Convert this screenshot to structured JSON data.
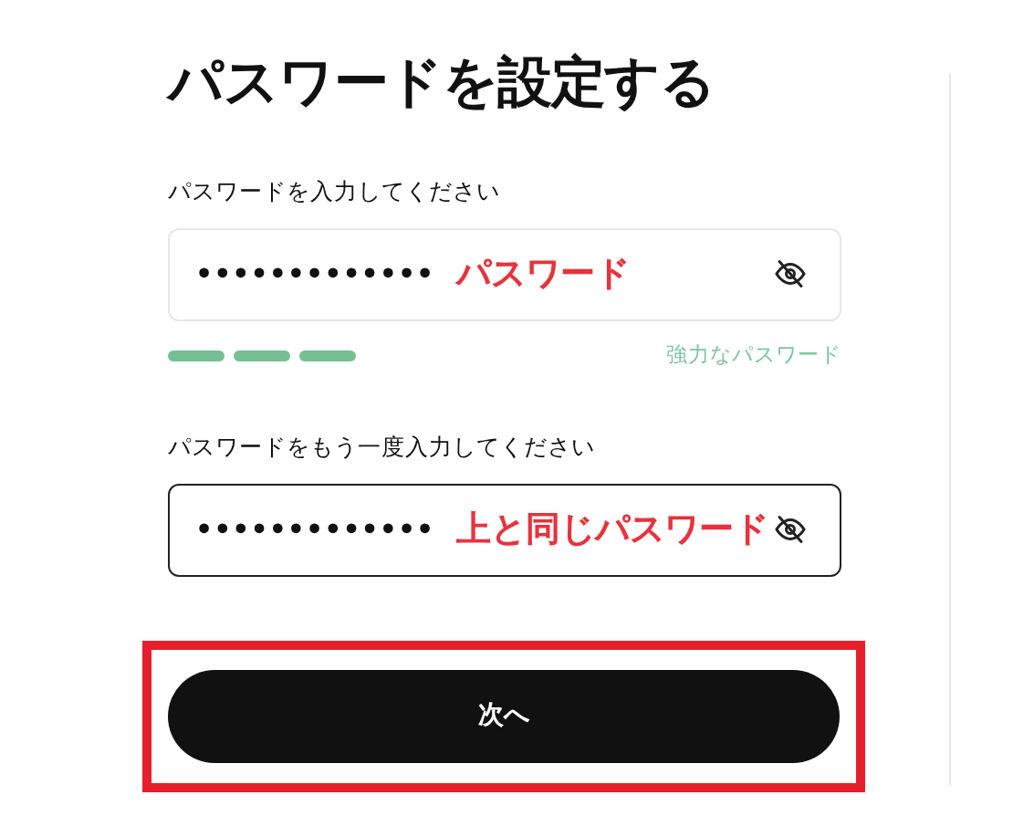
{
  "title": "パスワードを設定する",
  "fields": [
    {
      "label": "パスワードを入力してください",
      "value": "•••••••••••••",
      "focused": false,
      "annotation": "パスワード"
    },
    {
      "label": "パスワードをもう一度入力してください",
      "value": "•••••••••••••",
      "focused": true,
      "annotation": "上と同じパスワード"
    }
  ],
  "strength": {
    "segments": [
      {
        "filled": true
      },
      {
        "filled": true
      },
      {
        "filled": true
      }
    ],
    "label": "強力なパスワード"
  },
  "next_button": {
    "label": "次へ",
    "highlighted": true
  }
}
